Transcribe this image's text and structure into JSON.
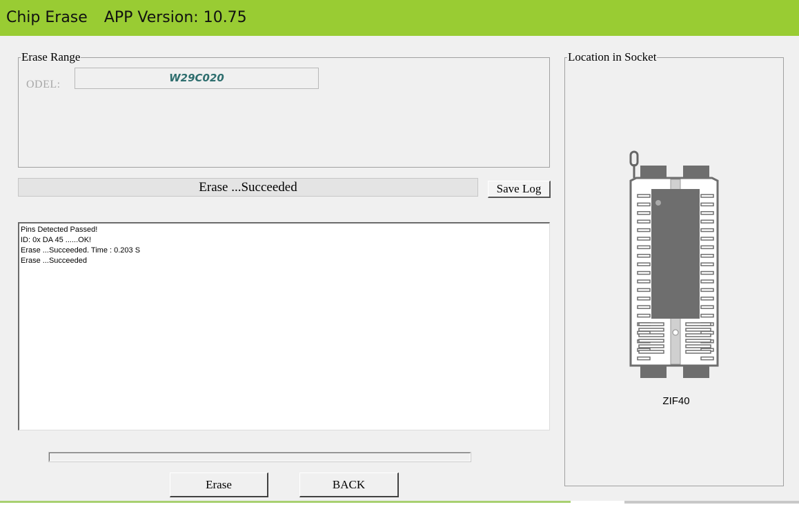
{
  "window": {
    "title": "Chip Erase",
    "app_version": "APP Version: 10.75",
    "accent_color": "#99cc33"
  },
  "erase_range": {
    "legend": "Erase Range",
    "model_label": "ODEL:",
    "model_value": "W29C020"
  },
  "status": {
    "text": "Erase  ...Succeeded"
  },
  "buttons": {
    "save_log": "Save Log",
    "erase": "Erase",
    "back": "BACK"
  },
  "log": {
    "lines": [
      "Pins Detected Passed!",
      "ID: 0x DA 45 ......OK!",
      "Erase  ...Succeeded. Time : 0.203 S",
      "Erase  ...Succeeded"
    ]
  },
  "progress": {
    "value": 0
  },
  "socket": {
    "legend": "Location in Socket",
    "socket_type": "ZIF40",
    "icon": "zif-socket-icon"
  }
}
